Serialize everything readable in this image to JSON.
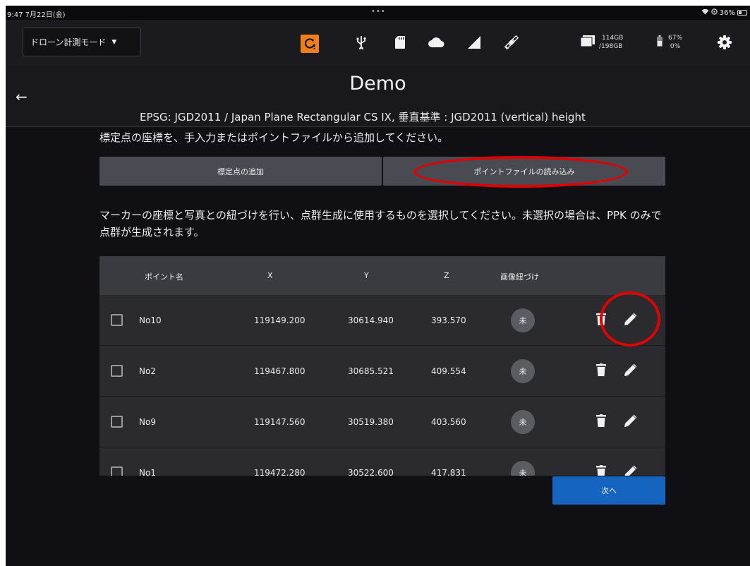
{
  "status_bar": {
    "time": "9:47  7月22日(金)",
    "dots": "•••",
    "battery": "36%"
  },
  "toolbar": {
    "mode_label": "ドローン計測モード",
    "storage_used": "114GB",
    "storage_total": "/198GB",
    "battery_pct": "67%",
    "battery_pct2": "0%",
    "accent_color": "#f07f1a",
    "icons": [
      "warning-icon",
      "usb-icon",
      "sd-card-icon",
      "cloud-icon",
      "signal-icon",
      "satellite-icon",
      "folder-icon",
      "battery-icon",
      "gear-icon"
    ]
  },
  "header": {
    "title": "Demo",
    "crs": "EPSG: JGD2011 / Japan Plane Rectangular CS IX, 垂直基準 : JGD2011 (vertical) height"
  },
  "instructions": {
    "top": "標定点の座標を、手入力またはポイントファイルから追加してください。",
    "middle": "マーカーの座標と写真との紐づけを行い、点群生成に使用するものを選択してください。未選択の場合は、PPK のみで点群が生成されます。"
  },
  "buttons": {
    "add_point": "標定点の追加",
    "load_point_file": "ポイントファイルの読み込み",
    "next": "次へ"
  },
  "table": {
    "columns": [
      "ポイント名",
      "X",
      "Y",
      "Z",
      "画像紐づけ"
    ],
    "rows": [
      {
        "name": "No10",
        "x": "119149.200",
        "y": "30614.940",
        "z": "393.570",
        "link": "未"
      },
      {
        "name": "No2",
        "x": "119467.800",
        "y": "30685.521",
        "z": "409.554",
        "link": "未"
      },
      {
        "name": "No9",
        "x": "119147.560",
        "y": "30519.380",
        "z": "403.560",
        "link": "未"
      },
      {
        "name": "No1",
        "x": "119472.280",
        "y": "30522.600",
        "z": "417.831",
        "link": "未"
      }
    ]
  }
}
